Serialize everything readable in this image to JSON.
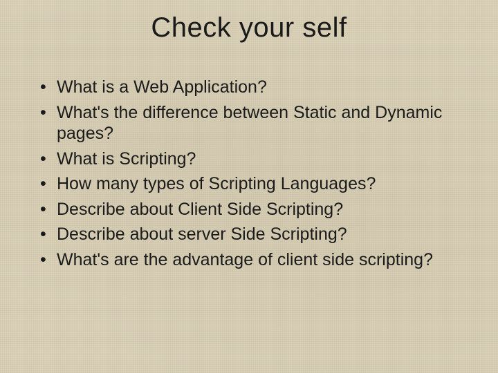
{
  "slide": {
    "title": "Check your self",
    "bullets": [
      "What is a Web Application?",
      "What's the difference between Static and Dynamic pages?",
      "What is Scripting?",
      "How many types of Scripting Languages?",
      "Describe about Client Side Scripting?",
      "Describe about server Side Scripting?",
      "What's are the advantage of client side scripting?"
    ]
  }
}
